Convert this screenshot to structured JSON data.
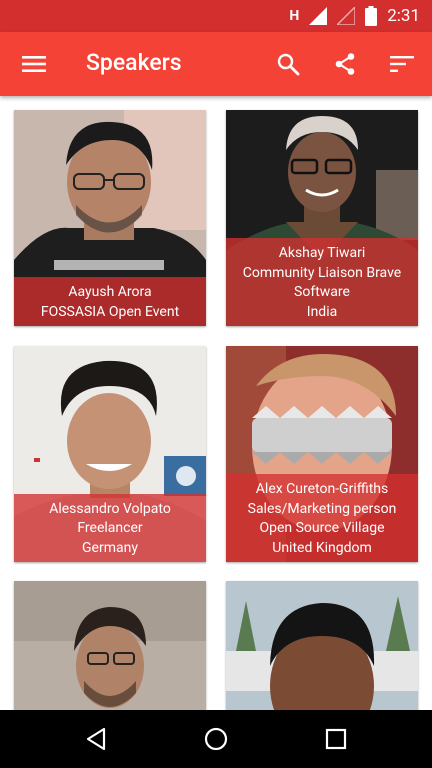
{
  "status_bar": {
    "network_label": "H",
    "time": "2:31"
  },
  "app_bar": {
    "title": "Speakers"
  },
  "speakers": [
    {
      "name": "Aayush Arora",
      "lines": [
        "FOSSASIA Open Event"
      ]
    },
    {
      "name": "Akshay Tiwari",
      "lines": [
        "Community Liaison Brave",
        "Software",
        "India"
      ]
    },
    {
      "name": "Alessandro Volpato",
      "lines": [
        "Freelancer",
        "Germany"
      ]
    },
    {
      "name": "Alex Cureton-Griffiths",
      "lines": [
        "Sales/Marketing person",
        "Open Source Village",
        "United Kingdom"
      ]
    }
  ],
  "colors": {
    "status_bar": "#d32f2f",
    "app_bar": "#f44336",
    "caption_overlay": "#d32f2f"
  },
  "icons": {
    "menu": "hamburger-icon",
    "search": "search-icon",
    "share": "share-icon",
    "sort": "sort-icon",
    "back": "back-triangle-icon",
    "home": "home-circle-icon",
    "recents": "recents-square-icon"
  }
}
